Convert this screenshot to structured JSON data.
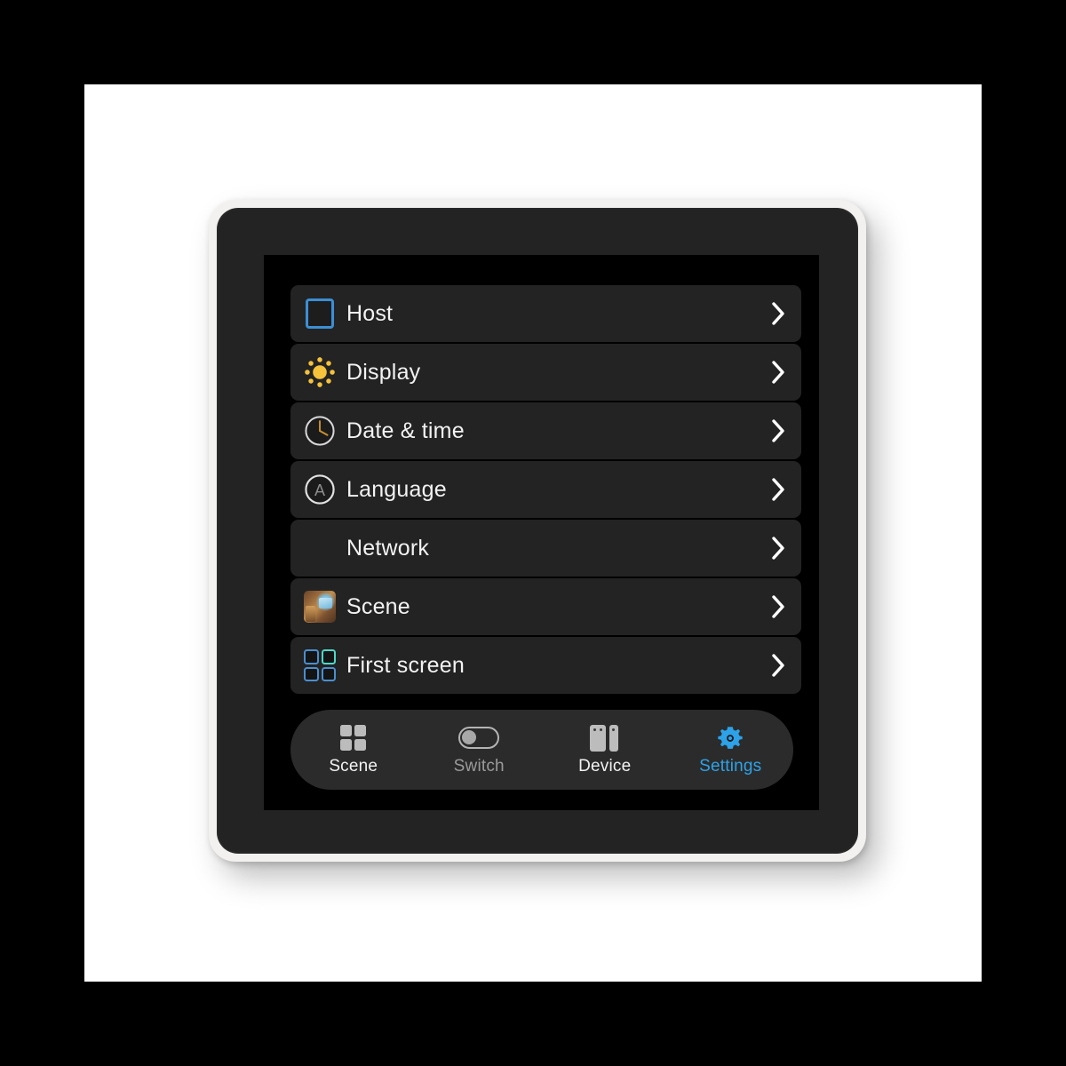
{
  "device": {
    "frame_color": "#f2f1ef",
    "bezel_color": "#232323",
    "screen_color": "#000000"
  },
  "theme": {
    "row_bg": "#232323",
    "text": "#f2f2f2",
    "accent": "#2da2e8",
    "host_blue": "#3b8fd4",
    "sun_yellow": "#f5c23c",
    "teal": "#4fd8c8",
    "muted": "#9a9a9a"
  },
  "settings": {
    "rows": [
      {
        "label": "Host",
        "icon": "host-square-icon",
        "chevron": "chevron-right-icon"
      },
      {
        "label": "Display",
        "icon": "sun-brightness-icon",
        "chevron": "chevron-right-icon"
      },
      {
        "label": "Date & time",
        "icon": "clock-icon",
        "chevron": "chevron-right-icon"
      },
      {
        "label": "Language",
        "icon": "language-a-icon",
        "chevron": "chevron-right-icon"
      },
      {
        "label": "Network",
        "icon": "none",
        "chevron": "chevron-right-icon"
      },
      {
        "label": "Scene",
        "icon": "scene-photo-icon",
        "chevron": "chevron-right-icon"
      },
      {
        "label": "First screen",
        "icon": "grid-four-icon",
        "chevron": "chevron-right-icon"
      }
    ]
  },
  "tab_bar": {
    "tabs": [
      {
        "label": "Scene",
        "icon": "grid-squares-icon",
        "state": "normal"
      },
      {
        "label": "Switch",
        "icon": "toggle-off-icon",
        "state": "dim"
      },
      {
        "label": "Device",
        "icon": "device-panels-icon",
        "state": "normal"
      },
      {
        "label": "Settings",
        "icon": "gear-icon",
        "state": "active"
      }
    ]
  }
}
